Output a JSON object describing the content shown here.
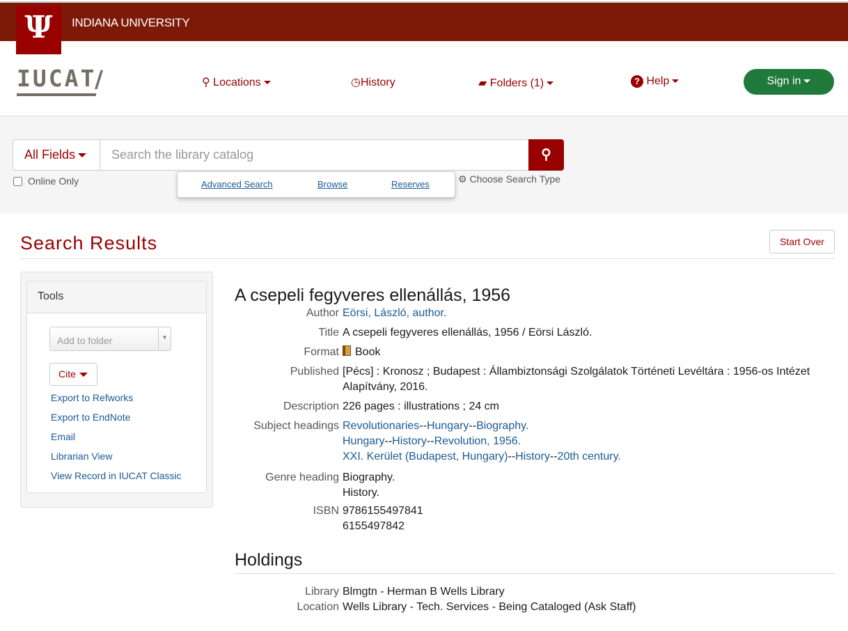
{
  "header": {
    "university": "INDIANA UNIVERSITY",
    "logo_text": "IU",
    "brand": "IUCAT",
    "slash": "/"
  },
  "nav": {
    "locations": "Locations",
    "history": "History",
    "folders": "Folders (1)",
    "help": "Help",
    "signin": "Sign in"
  },
  "search": {
    "field": "All Fields",
    "placeholder": "Search the library catalog",
    "online_only": "Online Only",
    "advanced": "Advanced Search",
    "browse": "Browse",
    "reserves": "Reserves",
    "choose_type": "Choose Search Type"
  },
  "results": {
    "title": "Search Results",
    "start_over": "Start Over"
  },
  "tools": {
    "title": "Tools",
    "add_to_folder": "Add to folder",
    "cite": "Cite",
    "items": [
      "Export to Refworks",
      "Export to EndNote",
      "Email",
      "Librarian View",
      "View Record in IUCAT Classic"
    ]
  },
  "record": {
    "title": "A csepeli fegyveres ellenállás, 1956",
    "author_label": "Author",
    "author": "Eörsi, László, author.",
    "title_label": "Title",
    "title_full": "A csepeli fegyveres ellenállás, 1956 / Eörsi László.",
    "format_label": "Format",
    "format": "Book",
    "published_label": "Published",
    "published": "[Pécs] : Kronosz ; Budapest : Állambiztonsági Szolgálatok Történeti Levéltára : 1956-os Intézet Alapítvány, 2016.",
    "description_label": "Description",
    "description": "226 pages : illustrations ; 24 cm",
    "subjects_label": "Subject headings",
    "subjects": [
      [
        "Revolutionaries",
        "Hungary",
        "Biography."
      ],
      [
        "Hungary",
        "History",
        "Revolution, 1956."
      ],
      [
        "XXI. Kerület (Budapest, Hungary)",
        "History",
        "20th century."
      ]
    ],
    "subject_sep": "--",
    "genre_label": "Genre heading",
    "genres": [
      "Biography.",
      "History."
    ],
    "isbn_label": "ISBN",
    "isbns": [
      "9786155497841",
      "6155497842"
    ]
  },
  "holdings": {
    "title": "Holdings",
    "library_label": "Library",
    "library": "Blmgtn - Herman B Wells Library",
    "location_label": "Location",
    "location": "Wells Library - Tech. Services - Being Cataloged (Ask Staff)"
  }
}
